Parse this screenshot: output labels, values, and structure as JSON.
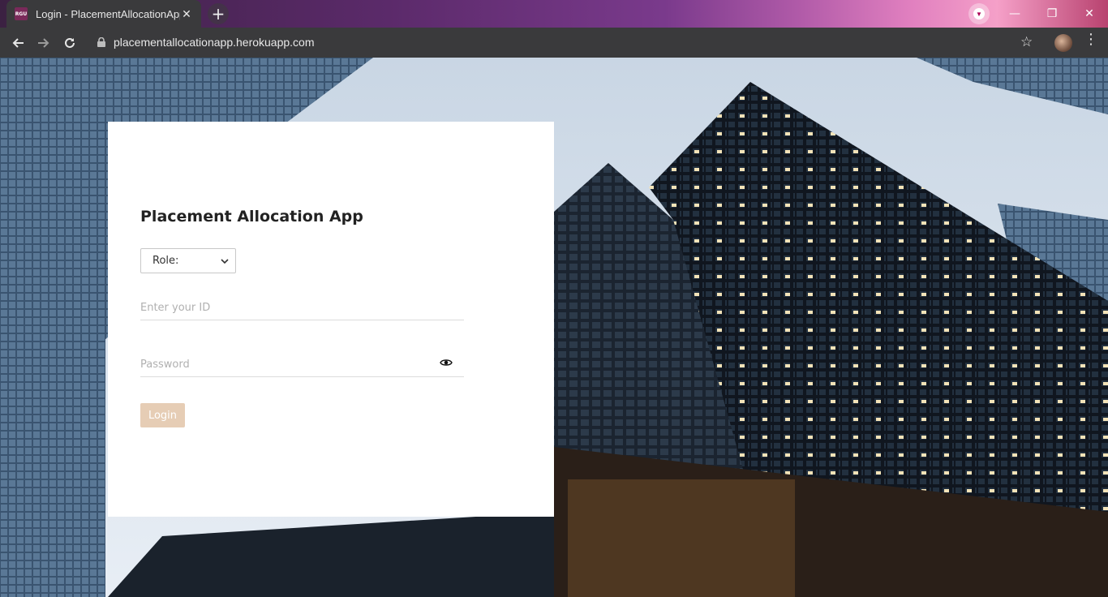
{
  "browser": {
    "tab_title": "Login - PlacementAllocationApp",
    "favicon_text": "RGU",
    "tab_close": "✕",
    "new_tab": "+",
    "url": "placementallocationapp.herokuapp.com",
    "window": {
      "minimize": "—",
      "restore": "❐",
      "close": "✕"
    }
  },
  "login": {
    "title": "Placement Allocation App",
    "role_select": {
      "selected": "Role:"
    },
    "id_placeholder": "Enter your ID",
    "password_placeholder": "Password",
    "login_label": "Login"
  },
  "colors": {
    "card_bg": "#ffffff",
    "login_button_bg": "#e6cdb5",
    "chrome_toolbar": "#3a3a3c"
  },
  "icons": [
    "favicon",
    "close-icon",
    "plus-icon",
    "back-arrow-icon",
    "forward-arrow-icon",
    "reload-icon",
    "lock-icon",
    "star-icon",
    "kebab-menu-icon",
    "chevron-down-icon",
    "eye-icon"
  ]
}
